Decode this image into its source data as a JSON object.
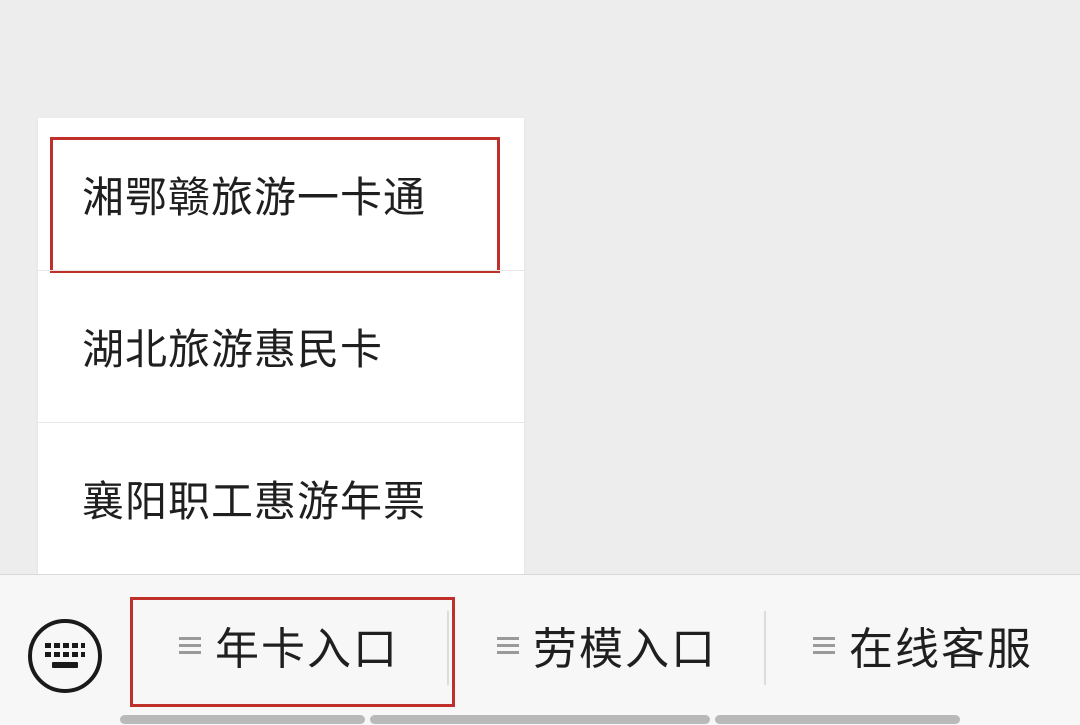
{
  "submenu": {
    "items": [
      {
        "label": "湘鄂赣旅游一卡通",
        "highlighted": true
      },
      {
        "label": "湖北旅游惠民卡",
        "highlighted": false
      },
      {
        "label": "襄阳职工惠游年票",
        "highlighted": false
      }
    ]
  },
  "menubar": {
    "keyboard_icon": "keyboard-icon",
    "tabs": [
      {
        "label": "年卡入口",
        "icon": "hamburger-icon",
        "highlighted": true
      },
      {
        "label": "劳模入口",
        "icon": "hamburger-icon",
        "highlighted": false
      },
      {
        "label": "在线客服",
        "icon": "hamburger-icon",
        "highlighted": false
      }
    ]
  },
  "colors": {
    "highlight_border": "#c0302b",
    "background": "#ededed",
    "menu_bg": "#ffffff",
    "text": "#1f1f1f"
  }
}
